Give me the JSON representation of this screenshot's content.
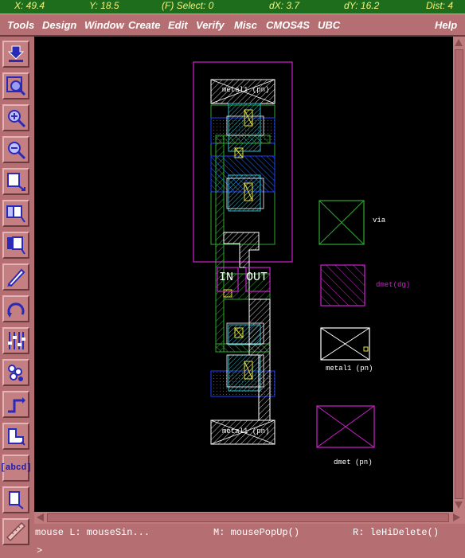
{
  "status": {
    "x": "X:  49.4",
    "y": "Y:  18.5",
    "select": "(F) Select: 0",
    "dx": "dX:  3.7",
    "dy": "dY:  16.2",
    "dist": "Dist:  4"
  },
  "menu": [
    "Tools",
    "Design",
    "Window",
    "Create",
    "Edit",
    "Verify",
    "Misc",
    "CMOS4S",
    "UBC",
    "Help"
  ],
  "tools": [
    {
      "name": "save-icon"
    },
    {
      "name": "zoom-fit-icon"
    },
    {
      "name": "zoom-in-icon"
    },
    {
      "name": "zoom-out-icon"
    },
    {
      "name": "stretch-icon"
    },
    {
      "name": "copy-icon"
    },
    {
      "name": "move-icon"
    },
    {
      "name": "delete-icon"
    },
    {
      "name": "undo-icon"
    },
    {
      "name": "properties-icon"
    },
    {
      "name": "instance-icon"
    },
    {
      "name": "path-icon"
    },
    {
      "name": "polygon-icon"
    },
    {
      "name": "label-icon",
      "text": "[abcd]"
    },
    {
      "name": "rectangle-icon"
    },
    {
      "name": "ruler-icon"
    }
  ],
  "layout": {
    "top_contact_label": "metal1 (pn)",
    "bottom_contact_label": "metal1 (pn)",
    "in_label": "IN",
    "out_label": "OUT"
  },
  "legend": {
    "via": "via",
    "dmet_dg": "dmet(dg)",
    "metal1_pn": "metal1 (pn)",
    "dmet_pn": "dmet (pn)"
  },
  "mouse": {
    "left": "mouse L: mouseSin...",
    "middle": "M: mousePopUp()",
    "right": "R: leHiDelete()"
  },
  "prompt": ">"
}
